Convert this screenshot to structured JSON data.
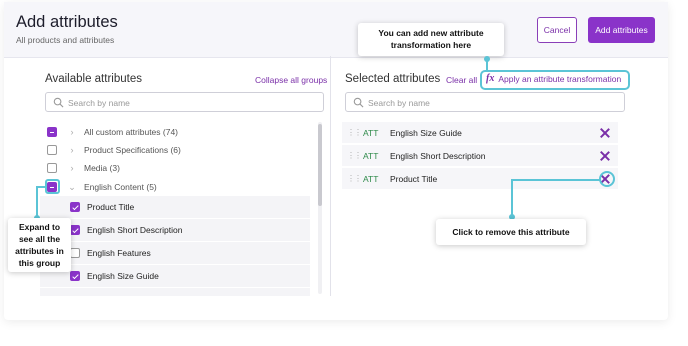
{
  "header": {
    "title": "Add attributes",
    "subtitle": "All products and attributes",
    "cancel_label": "Cancel",
    "add_label": "Add attributes"
  },
  "left_panel": {
    "title": "Available attributes",
    "collapse_label": "Collapse all groups",
    "search_placeholder": "Search by name",
    "groups": [
      {
        "label": "All custom attributes (74)",
        "state": "indeterminate"
      },
      {
        "label": "Product Specifications (6)",
        "state": "unchecked"
      },
      {
        "label": "Media (3)",
        "state": "unchecked"
      },
      {
        "label": "English Content (5)",
        "state": "indeterminate",
        "expanded": true
      }
    ],
    "children": [
      {
        "label": "Product Title",
        "checked": true
      },
      {
        "label": "English Short Description",
        "checked": true
      },
      {
        "label": "English Features",
        "checked": false
      },
      {
        "label": "English Size Guide",
        "checked": true
      }
    ]
  },
  "right_panel": {
    "title": "Selected attributes",
    "clear_label": "Clear all",
    "transform_label": "Apply an attribute transformation",
    "search_placeholder": "Search by name",
    "items": [
      {
        "type": "ATT",
        "label": "English Size Guide"
      },
      {
        "type": "ATT",
        "label": "English Short Description"
      },
      {
        "type": "ATT",
        "label": "Product Title"
      }
    ]
  },
  "callouts": {
    "transform_line1": "You can add new attribute",
    "transform_line2": "transformation here",
    "expand_line1": "Expand to",
    "expand_line2": "see all the",
    "expand_line3": "attributes in",
    "expand_line4": "this group",
    "remove": "Click to remove this attribute"
  },
  "colors": {
    "accent": "#8a33c9",
    "annotation": "#5bc4d6",
    "att_tag": "#2e8a4a"
  }
}
